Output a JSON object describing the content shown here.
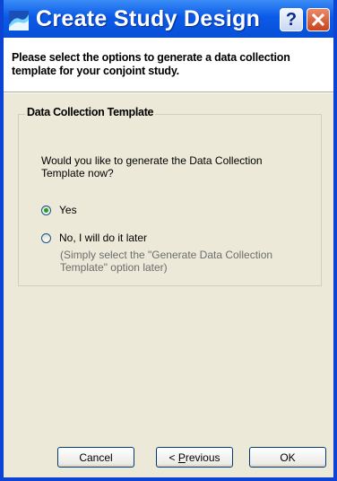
{
  "window": {
    "title": "Create Study Design"
  },
  "header": {
    "instructions": "Please select the options to generate a data collection template for your conjoint study."
  },
  "group": {
    "title": "Data Collection Template",
    "question": "Would you like to generate the Data Collection Template now?",
    "options": [
      {
        "label": "Yes",
        "checked": true
      },
      {
        "label": "No, I will do it later",
        "checked": false
      }
    ],
    "note": "(Simply select the \"Generate Data Collection Template\" option later)"
  },
  "buttons": {
    "cancel": "Cancel",
    "previous_prefix": "< ",
    "previous_mnemonic": "P",
    "previous_rest": "revious",
    "ok": "OK"
  },
  "icons": {
    "app": "app-wave-icon",
    "help": "help-icon",
    "close": "close-icon"
  },
  "colors": {
    "titlebar": "#0a5ae8",
    "window_bg": "#ece9d8",
    "close": "#c9421c"
  }
}
